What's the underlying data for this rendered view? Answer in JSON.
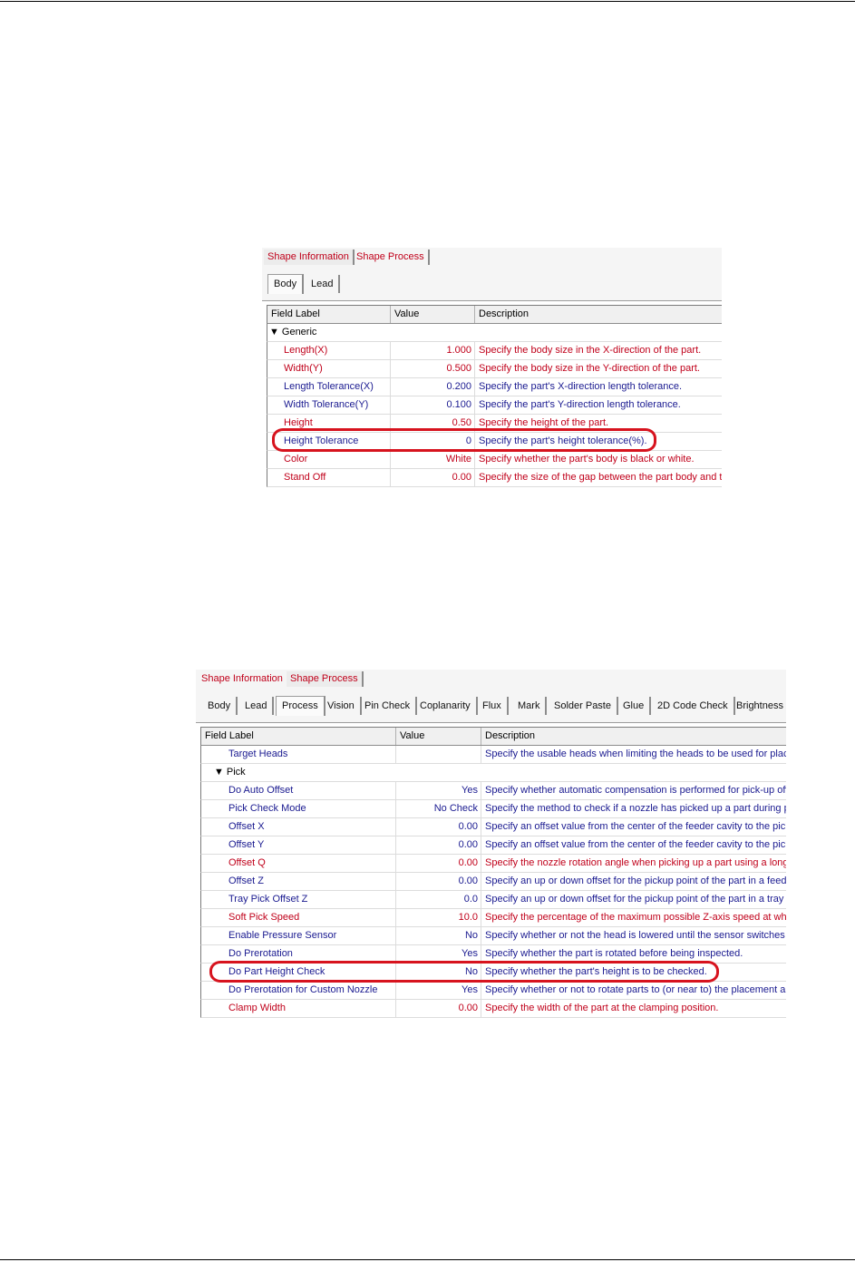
{
  "shot1": {
    "top_tabs": [
      "Shape Information",
      "Shape Process"
    ],
    "sub_tabs": [
      "Body",
      "Lead"
    ],
    "columns": [
      "Field Label",
      "Value",
      "Description"
    ],
    "group": "Generic",
    "rows": [
      {
        "label": "Length(X)",
        "value": "1.000",
        "desc": "Specify the body size in the X-direction of the part.",
        "color": "red"
      },
      {
        "label": "Width(Y)",
        "value": "0.500",
        "desc": "Specify the body size in the Y-direction of the part.",
        "color": "red"
      },
      {
        "label": "Length Tolerance(X)",
        "value": "0.200",
        "desc": "Specify the part's X-direction length tolerance.",
        "color": "blue"
      },
      {
        "label": "Width Tolerance(Y)",
        "value": "0.100",
        "desc": "Specify the part's Y-direction length tolerance.",
        "color": "blue"
      },
      {
        "label": "Height",
        "value": "0.50",
        "desc": "Specify the height of the part.",
        "color": "red"
      },
      {
        "label": "Height Tolerance",
        "value": "0",
        "desc": "Specify the part's height tolerance(%).",
        "color": "blue"
      },
      {
        "label": "Color",
        "value": "White",
        "desc": "Specify whether the part's body is black or white.",
        "color": "red"
      },
      {
        "label": "Stand Off",
        "value": "0.00",
        "desc": "Specify the size of the gap between the part body and the",
        "color": "red"
      }
    ]
  },
  "shot2": {
    "top_tabs": [
      "Shape Information",
      "Shape Process"
    ],
    "sub_tabs": [
      "Body",
      "Lead",
      "Process",
      "Vision",
      "Pin Check",
      "Coplanarity",
      "Flux",
      "Mark",
      "Solder Paste",
      "Glue",
      "2D Code Check",
      "Brightness C"
    ],
    "columns": [
      "Field Label",
      "Value",
      "Description"
    ],
    "target_heads": {
      "label": "Target Heads",
      "value": "",
      "desc": "Specify the usable heads when limiting the heads to be used for placing",
      "color": "blue"
    },
    "group": "Pick",
    "rows": [
      {
        "label": "Do Auto Offset",
        "value": "Yes",
        "desc": "Specify whether automatic compensation is performed for pick-up offse",
        "color": "blue"
      },
      {
        "label": "Pick Check Mode",
        "value": "No Check",
        "desc": "Specify the method to check if a nozzle has picked up a part during pic",
        "color": "blue"
      },
      {
        "label": "Offset X",
        "value": "0.00",
        "desc": "Specify an offset value from the center of the feeder cavity to the pick-",
        "color": "blue"
      },
      {
        "label": "Offset Y",
        "value": "0.00",
        "desc": "Specify an offset value from the center of the feeder cavity to the pick-",
        "color": "blue"
      },
      {
        "label": "Offset Q",
        "value": "0.00",
        "desc": "Specify the nozzle rotation angle when picking up a part using a long n",
        "color": "red"
      },
      {
        "label": "Offset Z",
        "value": "0.00",
        "desc": "Specify an up or down offset for the pickup point of the part in a feeder",
        "color": "blue"
      },
      {
        "label": "Tray Pick Offset Z",
        "value": "0.0",
        "desc": "Specify an up or down offset for the pickup point of the part in a tray ca",
        "color": "blue"
      },
      {
        "label": "Soft Pick Speed",
        "value": "10.0",
        "desc": "Specify the percentage of the maximum possible Z-axis speed at which",
        "color": "red"
      },
      {
        "label": "Enable Pressure Sensor",
        "value": "No",
        "desc": "Specify whether or not the head is lowered until the sensor switches on",
        "color": "blue"
      },
      {
        "label": "Do Prerotation",
        "value": "Yes",
        "desc": "Specify whether the part is rotated before being inspected.",
        "color": "blue"
      },
      {
        "label": "Do Part Height Check",
        "value": "No",
        "desc": "Specify whether the part's height is to be checked.",
        "color": "blue"
      },
      {
        "label": "Do Prerotation for Custom Nozzle",
        "value": "Yes",
        "desc": "Specify whether or not to rotate parts to (or near to) the placement angl",
        "color": "blue"
      },
      {
        "label": "Clamp Width",
        "value": "0.00",
        "desc": "Specify the width of the part at the clamping position.",
        "color": "red"
      }
    ]
  },
  "colors": {
    "red": "#c0001a",
    "blue": "#1a1a90",
    "highlight": "#d7131e"
  }
}
